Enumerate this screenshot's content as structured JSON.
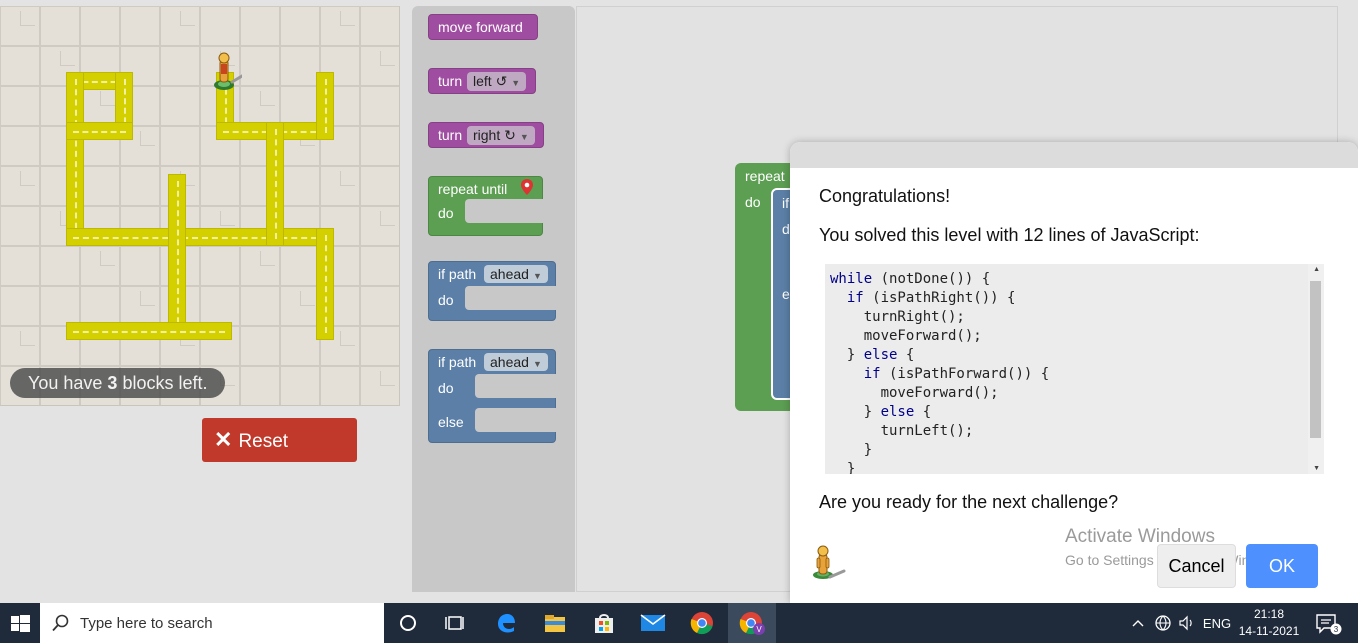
{
  "maze": {
    "blocks_left_prefix": "You have ",
    "blocks_left_count": "3",
    "blocks_left_suffix": " blocks left."
  },
  "controls": {
    "reset_label": "Reset"
  },
  "toolbox": {
    "move_forward": "move forward",
    "turn_label": "turn",
    "left_option": "left ↺",
    "right_option": "right ↻",
    "repeat_until": "repeat until",
    "do_label": "do",
    "if_path": "if path",
    "ahead_option": "ahead",
    "else_label": "else"
  },
  "workspace": {
    "repeat_label": "repeat",
    "do_label": "do",
    "if_fragment": "if",
    "d_fragment": "d",
    "e_fragment": "e"
  },
  "dialog": {
    "congrats": "Congratulations!",
    "solved": "You solved this level with 12 lines of JavaScript:",
    "code": [
      "while (notDone()) {",
      "  if (isPathRight()) {",
      "    turnRight();",
      "    moveForward();",
      "  } else {",
      "    if (isPathForward()) {",
      "      moveForward();",
      "    } else {",
      "      turnLeft();",
      "    }",
      "  }"
    ],
    "next_question": "Are you ready for the next challenge?",
    "cancel_label": "Cancel",
    "ok_label": "OK"
  },
  "watermark": {
    "title": "Activate Windows",
    "subtitle": "Go to Settings to activate Windows."
  },
  "taskbar": {
    "search_placeholder": "Type here to search",
    "language": "ENG",
    "time": "21:18",
    "date": "14-11-2021",
    "notification_count": "3",
    "icons": [
      "cortana-icon",
      "task-view-icon",
      "edge-icon",
      "file-explorer-icon",
      "store-icon",
      "mail-icon",
      "chrome-icon",
      "chrome-profile-icon"
    ]
  },
  "colors": {
    "path_yellow": "#d4d000",
    "reset_red": "#c0392b",
    "ok_blue": "#4d90fe",
    "block_purple": "#9f4da0",
    "block_green": "#5c9e52",
    "block_blue": "#5b7fa6"
  }
}
